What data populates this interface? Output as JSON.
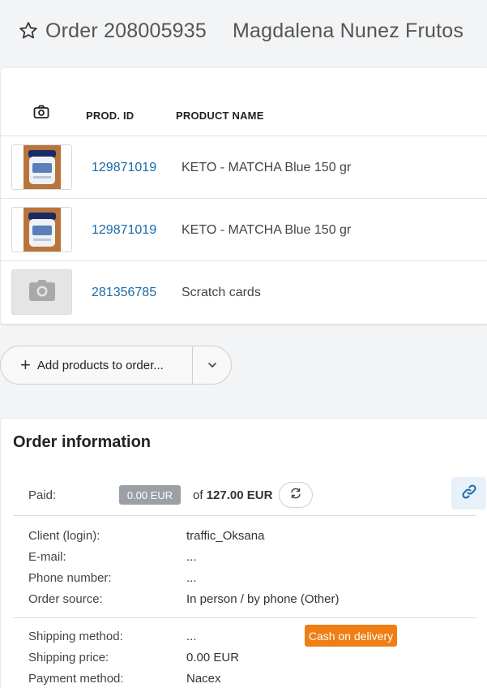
{
  "header": {
    "order_title": "Order 208005935",
    "customer_name": "Magdalena Nunez Frutos"
  },
  "products": {
    "columns": {
      "photo_icon": "camera-icon",
      "prod_id": "PROD. ID",
      "product_name": "PRODUCT NAME"
    },
    "rows": [
      {
        "id": "129871019",
        "name": "KETO - MATCHA Blue 150 gr",
        "image": "product-jar"
      },
      {
        "id": "129871019",
        "name": "KETO - MATCHA Blue 150 gr",
        "image": "product-jar"
      },
      {
        "id": "281356785",
        "name": "Scratch cards",
        "image": "placeholder-camera"
      }
    ]
  },
  "add_products": {
    "label": "Add products to order..."
  },
  "order_info": {
    "title": "Order information",
    "paid_label": "Paid:",
    "paid_amount": "0.00 EUR",
    "of_prefix": "of",
    "total": "127.00 EUR",
    "client_label": "Client (login):",
    "client_value": "traffic_Oksana",
    "email_label": "E-mail:",
    "email_value": "...",
    "phone_label": "Phone number:",
    "phone_value": "...",
    "source_label": "Order source:",
    "source_value": "In person / by phone (Other)",
    "shipping_method_label": "Shipping method:",
    "shipping_method_value": "...",
    "cod_badge": "Cash on delivery",
    "shipping_price_label": "Shipping price:",
    "shipping_price_value": "0.00 EUR",
    "payment_method_label": "Payment method:",
    "payment_method_value": "Nacex"
  },
  "colors": {
    "link": "#1b6aa5",
    "badge_grey": "#9aa0a6",
    "badge_orange": "#ef7e14",
    "background": "#f3f4f6"
  }
}
